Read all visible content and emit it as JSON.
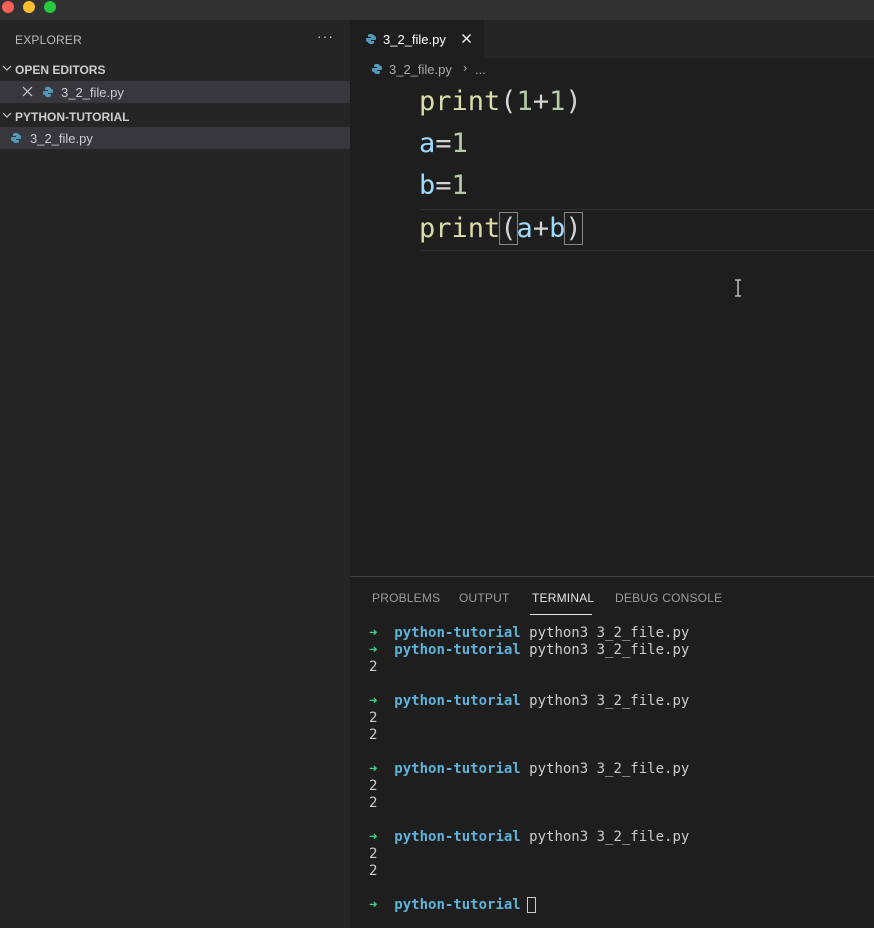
{
  "sidebar": {
    "header": "EXPLORER",
    "more_icon": "···",
    "open_editors": {
      "title": "OPEN EDITORS",
      "file": "3_2_file.py"
    },
    "project": {
      "title": "PYTHON-TUTORIAL",
      "file": "3_2_file.py"
    }
  },
  "editor": {
    "tab": {
      "label": "3_2_file.py"
    },
    "breadcrumb": {
      "file": "3_2_file.py",
      "separator": "›",
      "ellipsis": "..."
    },
    "lines": [
      "print(1+1)",
      "a=1",
      "b=1",
      "print(a+b)"
    ]
  },
  "panel": {
    "tabs": [
      "PROBLEMS",
      "OUTPUT",
      "TERMINAL",
      "DEBUG CONSOLE"
    ],
    "active_tab": "TERMINAL",
    "terminal": {
      "arrow": "➜",
      "dir": "python-tutorial",
      "command": "python3 3_2_file.py",
      "output": "2"
    }
  },
  "colors": {
    "accent_green": "#3fcf8e",
    "prompt_blue": "#5fb3da",
    "python_icon": "#519aba"
  }
}
